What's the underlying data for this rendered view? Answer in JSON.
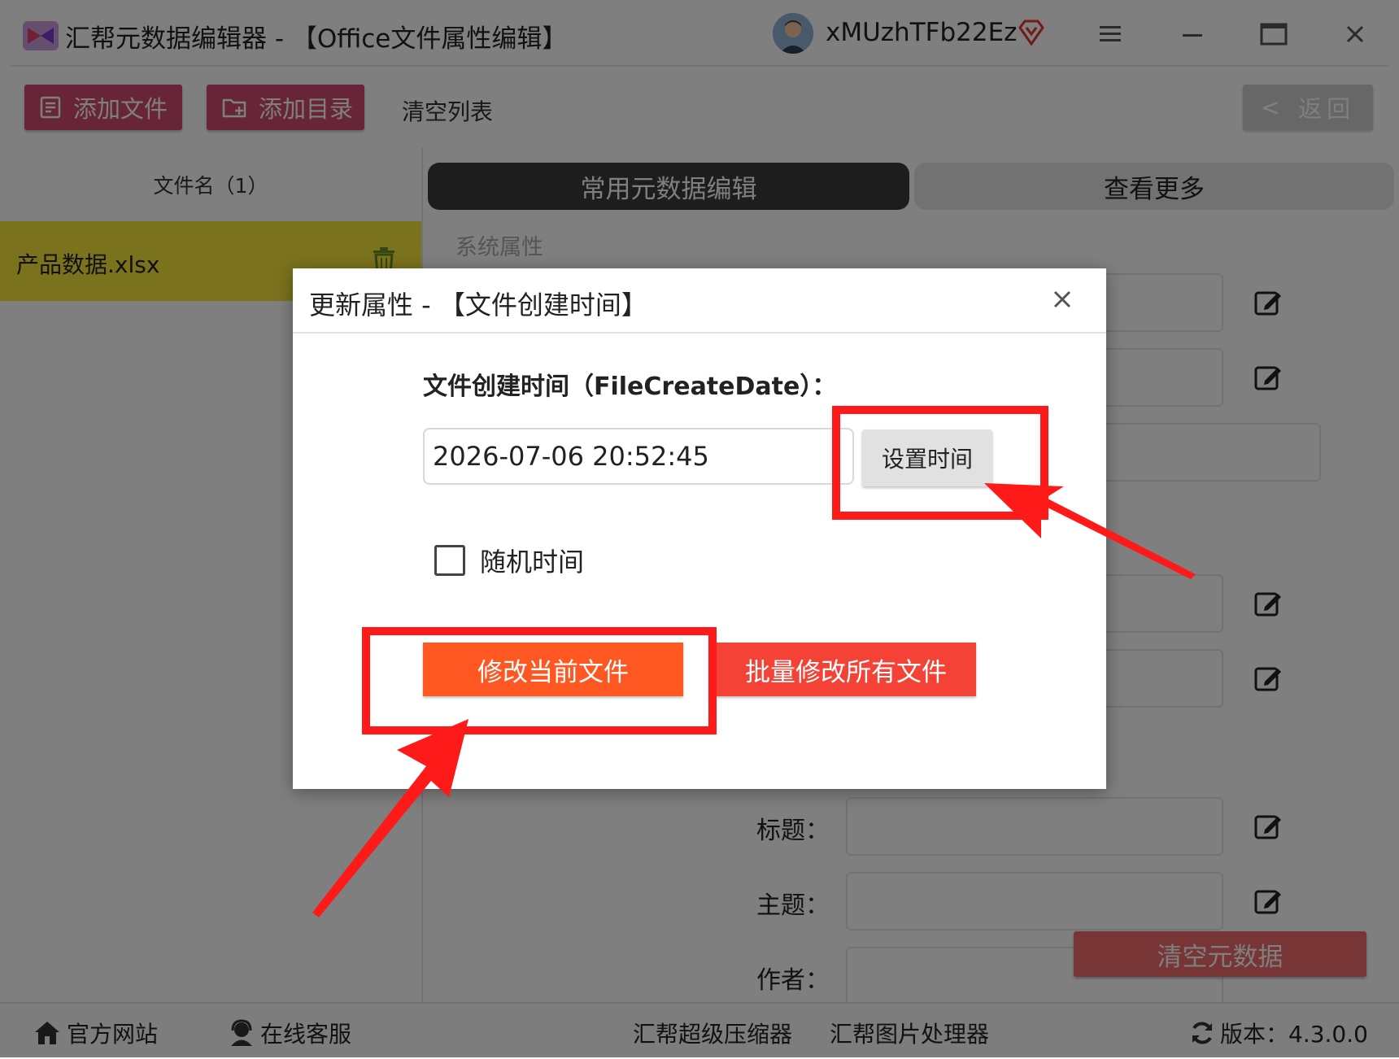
{
  "window": {
    "title": "汇帮元数据编辑器 - 【Office文件属性编辑】",
    "username": "xMUzhTFb22Ez"
  },
  "toolbar": {
    "add_file": "添加文件",
    "add_dir": "添加目录",
    "clear_list": "清空列表",
    "back": "返回"
  },
  "file_list": {
    "header": "文件名（1）",
    "items": [
      {
        "name": "产品数据.xlsx"
      }
    ]
  },
  "tabs": [
    {
      "label": "常用元数据编辑",
      "active": true
    },
    {
      "label": "查看更多",
      "active": false
    }
  ],
  "section": {
    "system_props": "系统属性"
  },
  "fields": {
    "title": "标题：",
    "subject": "主题：",
    "author": "作者："
  },
  "clear_meta": "清空元数据",
  "dialog": {
    "title": "更新属性 - 【文件创建时间】",
    "field_label": "文件创建时间（FileCreateDate）：",
    "value": "2026-07-06 20:52:45",
    "set_time": "设置时间",
    "random_time": "随机时间",
    "modify_current": "修改当前文件",
    "modify_all": "批量修改所有文件"
  },
  "statusbar": {
    "website": "官方网站",
    "support": "在线客服",
    "compressor": "汇帮超级压缩器",
    "image_tool": "汇帮图片处理器",
    "version": "版本：4.3.0.0"
  },
  "colors": {
    "accent_pink": "#d14a6e",
    "selected_row": "#f7e43a",
    "primary_orange": "#ff5722",
    "danger_red": "#f44336",
    "annotation_red": "#ff1a1a"
  }
}
